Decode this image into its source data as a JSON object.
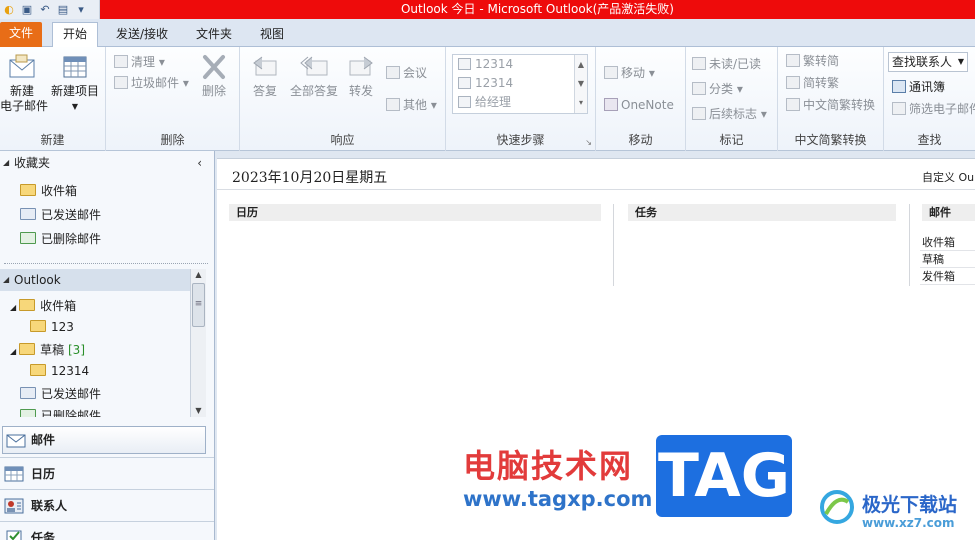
{
  "window": {
    "title": "Outlook 今日 - Microsoft Outlook(产品激活失败)"
  },
  "tabs": {
    "file": "文件",
    "home": "开始",
    "send_receive": "发送/接收",
    "folder": "文件夹",
    "view": "视图"
  },
  "ribbon": {
    "new_group": {
      "label": "新建",
      "new_email": "新建\n电子邮件",
      "new_items": "新建项目"
    },
    "delete_group": {
      "label": "删除",
      "cleanup": "清理",
      "junk": "垃圾邮件",
      "delete": "删除"
    },
    "respond_group": {
      "label": "响应",
      "reply": "答复",
      "reply_all": "全部答复",
      "forward": "转发",
      "meeting": "会议",
      "more": "其他"
    },
    "quick_steps_group": {
      "label": "快速步骤",
      "steps": [
        "12314",
        "12314",
        "给经理"
      ]
    },
    "move_group": {
      "label": "移动",
      "move": "移动",
      "onenote": "OneNote"
    },
    "tags_group": {
      "label": "标记",
      "unread_read": "未读/已读",
      "categorize": "分类",
      "follow_up": "后续标志"
    },
    "chinese_group": {
      "label": "中文简繁转换",
      "to_traditional": "繁转简",
      "to_simplified": "简转繁",
      "convert": "中文简繁转换"
    },
    "find_group": {
      "label": "查找",
      "find_contact": "查找联系人",
      "address_book": "通讯簿",
      "filter_email": "筛选电子邮件"
    }
  },
  "nav": {
    "favorites_header": "收藏夹",
    "favorites": [
      "收件箱",
      "已发送邮件",
      "已删除邮件"
    ],
    "outlook_header": "Outlook",
    "tree": {
      "inbox": "收件箱",
      "inbox_sub": "123",
      "drafts": "草稿",
      "drafts_count": "[3]",
      "drafts_sub": "12314",
      "sent": "已发送邮件",
      "deleted": "已删除邮件"
    },
    "buttons": {
      "mail": "邮件",
      "calendar": "日历",
      "contacts": "联系人",
      "tasks": "任务"
    }
  },
  "main": {
    "date": "2023年10月20日星期五",
    "customize": "自定义 Ou",
    "columns": {
      "calendar": "日历",
      "tasks": "任务",
      "mail": "邮件"
    },
    "mail_rows": [
      "收件箱",
      "草稿",
      "发件箱"
    ]
  },
  "watermarks": {
    "site1_name": "电脑技术网",
    "site1_url": "www.tagxp.com",
    "tag": "TAG",
    "site2_name": "极光下载站",
    "site2_url": "www.xz7.com"
  },
  "colors": {
    "title_bar": "#ee0b0b",
    "file_tab": "#e86d17",
    "accent": "#2e73c9"
  }
}
